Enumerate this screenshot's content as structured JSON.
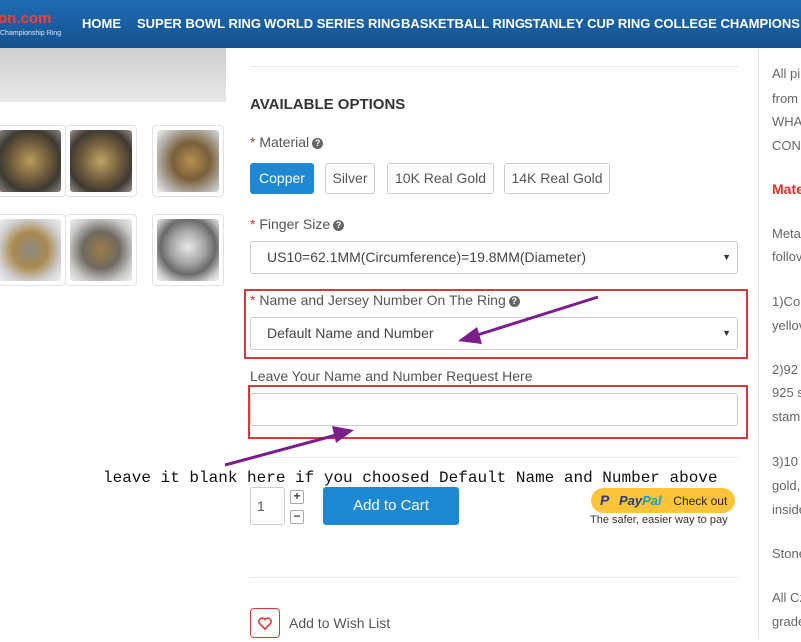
{
  "header": {
    "logo_text": "on.com",
    "logo_tagline": "Championship Ring",
    "nav": [
      "HOME",
      "SUPER BOWL RING",
      "WORLD SERIES RING",
      "BASKETBALL RING",
      "STANLEY CUP RING",
      "COLLEGE CHAMPIONS RIN"
    ]
  },
  "options": {
    "heading": "AVAILABLE OPTIONS",
    "required_mark": "*",
    "material": {
      "label": "Material",
      "choices": [
        "Copper",
        "Silver",
        "10K Real Gold",
        "14K Real Gold"
      ],
      "selected": "Copper"
    },
    "finger_size": {
      "label": "Finger Size",
      "value": "US10=62.1MM(Circumference)=19.8MM(Diameter)"
    },
    "name_number": {
      "label": "Name and Jersey Number On The Ring",
      "value": "Default Name and Number"
    },
    "request": {
      "label": "Leave Your Name and Number Request Here",
      "value": ""
    }
  },
  "annotation": {
    "note": "leave it blank here if you choosed Default Name and Number above"
  },
  "cart": {
    "quantity": "1",
    "plus": "+",
    "minus": "−",
    "add_to_cart": "Add to Cart",
    "paypal_brand_1": "Pay",
    "paypal_brand_2": "Pal",
    "paypal_checkout": "Check out",
    "paypal_tagline": "The safer, easier way to pay",
    "wishlist": "Add to Wish List"
  },
  "right_column": {
    "lines": [
      "All pi",
      "from",
      "WHA",
      "CONI",
      "Mate",
      "Meta",
      "follov",
      "1)Co",
      "yellov",
      "2)92",
      "925 s",
      "stam",
      "3)10",
      "gold,",
      "inside",
      "Stone",
      "All Cz",
      "grade"
    ]
  },
  "colors": {
    "header_bg": "#1a5fa3",
    "accent_blue": "#1e88d2",
    "highlight_red": "#d9393b",
    "arrow_purple": "#7a1e8c",
    "paypal_yellow": "#ffc439"
  }
}
